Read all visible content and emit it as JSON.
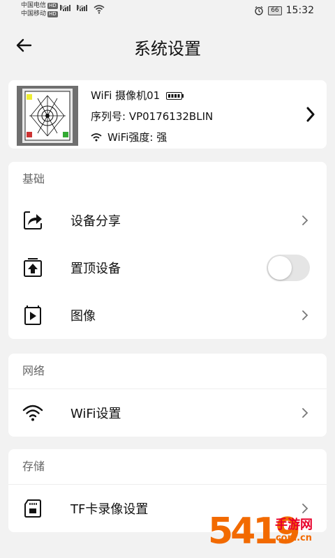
{
  "status_bar": {
    "carrier1": "中国电信",
    "carrier2": "中国移动",
    "hd": "HD",
    "net": "4G",
    "battery": "66",
    "time": "15:32"
  },
  "header": {
    "title": "系统设置"
  },
  "device": {
    "name": "WiFi 摄像机01",
    "serial": "序列号: VP0176132BLIN",
    "wifi_strength": "WiFi强度: 强"
  },
  "sections": {
    "basic": {
      "title": "基础",
      "share": "设备分享",
      "pin_top": "置顶设备",
      "pin_top_enabled": false,
      "image": "图像"
    },
    "network": {
      "title": "网络",
      "wifi": "WiFi设置"
    },
    "storage": {
      "title": "存储",
      "tf": "TF卡录像设置"
    }
  },
  "watermark": {
    "num": "5419",
    "cn": "手游网",
    "url": ".com.cn"
  },
  "colors": {
    "accent_watermark": "#f26a00",
    "background": "#f2f2f2",
    "card": "#ffffff"
  }
}
